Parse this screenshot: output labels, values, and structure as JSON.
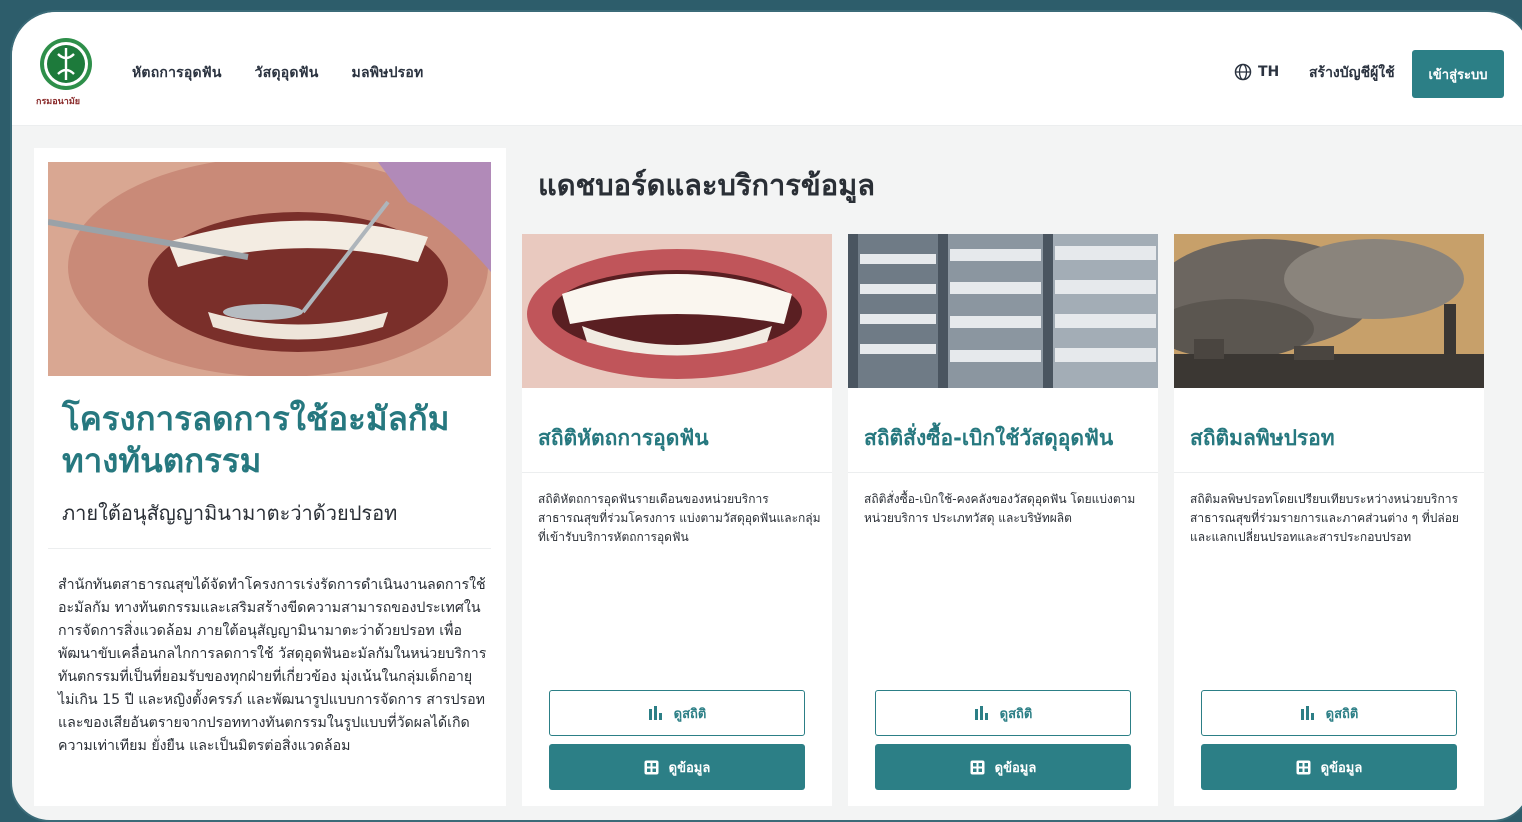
{
  "header": {
    "logo_text": "กรมอนามัย",
    "nav": [
      "หัตถการอุดฟัน",
      "วัสดุอุดฟัน",
      "มลพิษปรอท"
    ],
    "language": "TH",
    "register": "สร้างบัญชีผู้ใช้",
    "login": "เข้าสู่ระบบ"
  },
  "project": {
    "title": "โครงการลดการใช้อะมัลกัม ทางทันตกรรม",
    "subtitle": "ภายใต้อนุสัญญามินามาตะว่าด้วยปรอท",
    "description": "สำนักทันตสาธารณสุขได้จัดทำโครงการเร่งรัดการดำเนินงานลดการใช้อะมัลกัม ทางทันตกรรมและเสริมสร้างขีดความสามารถของประเทศในการจัดการสิ่งแวดล้อม ภายใต้อนุสัญญามินามาตะว่าด้วยปรอท เพื่อพัฒนาขับเคลื่อนกลไกการลดการใช้ วัสดุอุดฟันอะมัลกัมในหน่วยบริการทันตกรรมที่เป็นที่ยอมรับของทุกฝ่ายที่เกี่ยวข้อง มุ่งเน้นในกลุ่มเด็กอายุไม่เกิน 15 ปี และหญิงตั้งครรภ์ และพัฒนารูปแบบการจัดการ สารปรอทและของเสียอันตรายจากปรอททางทันตกรรมในรูปแบบที่วัดผลได้เกิด ความเท่าเทียม ยั่งยืน และเป็นมิตรต่อสิ่งแวดล้อม"
  },
  "section_title": "แดชบอร์ดและบริการข้อมูล",
  "cards": [
    {
      "title": "สถิติหัตถการอุดฟัน",
      "description": "สถิติหัตถการอุดฟันรายเดือนของหน่วยบริการสาธารณสุขที่ร่วมโครงการ แบ่งตามวัสดุอุดฟันและกลุ่มที่เข้ารับบริการหัตถการอุดฟัน",
      "btn_stats": "ดูสถิติ",
      "btn_data": "ดูข้อมูล"
    },
    {
      "title": "สถิติสั่งซื้อ-เบิกใช้วัสดุอุดฟัน",
      "description": "สถิติสั่งซื้อ-เบิกใช้-คงคลังของวัสดุอุดฟัน โดยแบ่งตามหน่วยบริการ ประเภทวัสดุ และบริษัทผลิต",
      "btn_stats": "ดูสถิติ",
      "btn_data": "ดูข้อมูล"
    },
    {
      "title": "สถิติมลพิษปรอท",
      "description": "สถิติมลพิษปรอทโดยเปรียบเทียบระหว่างหน่วยบริการสาธารณสุขที่ร่วมรายการและภาคส่วนต่าง ๆ ที่ปล่อยและแลกเปลี่ยนปรอทและสารประกอบปรอท",
      "btn_stats": "ดูสถิติ",
      "btn_data": "ดูข้อมูล"
    }
  ],
  "colors": {
    "accent": "#2c7f86",
    "title": "#26787f",
    "frame": "#2d5d6b"
  }
}
